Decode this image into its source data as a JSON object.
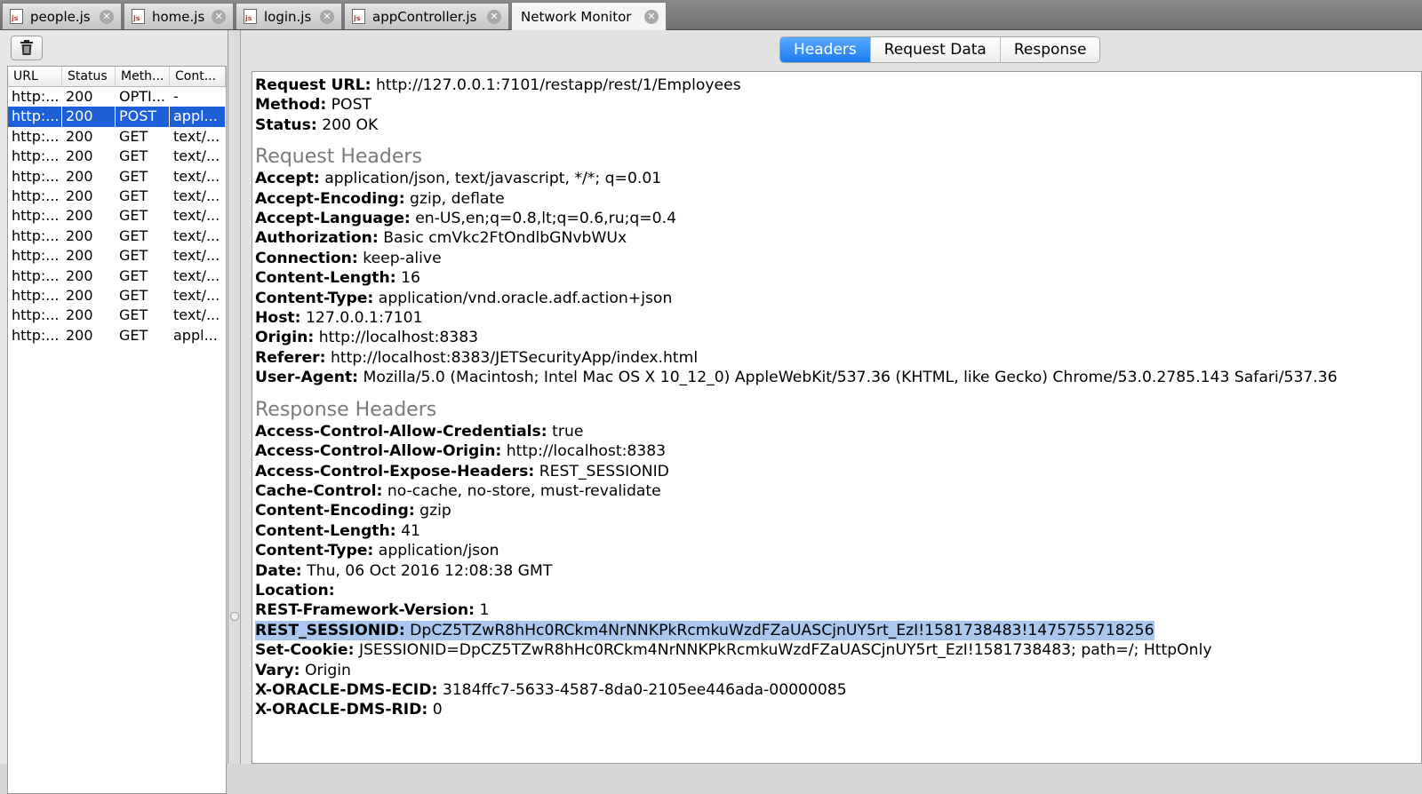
{
  "tabs": [
    {
      "label": "people.js"
    },
    {
      "label": "home.js"
    },
    {
      "label": "login.js"
    },
    {
      "label": "appController.js"
    },
    {
      "label": "Network Monitor"
    }
  ],
  "request_list": {
    "columns": [
      "URL",
      "Status",
      "Meth...",
      "Cont..."
    ],
    "rows": [
      {
        "url": "http:...",
        "status": "200",
        "method": "OPTI...",
        "type": "-"
      },
      {
        "url": "http:...",
        "status": "200",
        "method": "POST",
        "type": "appl..."
      },
      {
        "url": "http:...",
        "status": "200",
        "method": "GET",
        "type": "text/..."
      },
      {
        "url": "http:...",
        "status": "200",
        "method": "GET",
        "type": "text/..."
      },
      {
        "url": "http:...",
        "status": "200",
        "method": "GET",
        "type": "text/..."
      },
      {
        "url": "http:...",
        "status": "200",
        "method": "GET",
        "type": "text/..."
      },
      {
        "url": "http:...",
        "status": "200",
        "method": "GET",
        "type": "text/..."
      },
      {
        "url": "http:...",
        "status": "200",
        "method": "GET",
        "type": "text/..."
      },
      {
        "url": "http:...",
        "status": "200",
        "method": "GET",
        "type": "text/..."
      },
      {
        "url": "http:...",
        "status": "200",
        "method": "GET",
        "type": "text/..."
      },
      {
        "url": "http:...",
        "status": "200",
        "method": "GET",
        "type": "text/..."
      },
      {
        "url": "http:...",
        "status": "200",
        "method": "GET",
        "type": "text/..."
      },
      {
        "url": "http:...",
        "status": "200",
        "method": "GET",
        "type": "appl..."
      }
    ]
  },
  "detail_tabs": [
    "Headers",
    "Request Data",
    "Response"
  ],
  "summary": {
    "request_url_key": "Request URL:",
    "request_url": "http://127.0.0.1:7101/restapp/rest/1/Employees",
    "method_key": "Method:",
    "method": "POST",
    "status_key": "Status:",
    "status": "200 OK"
  },
  "request_headers_title": "Request Headers",
  "request_headers": [
    {
      "key": "Accept:",
      "value": "application/json, text/javascript, */*; q=0.01"
    },
    {
      "key": "Accept-Encoding:",
      "value": "gzip, deflate"
    },
    {
      "key": "Accept-Language:",
      "value": "en-US,en;q=0.8,lt;q=0.6,ru;q=0.4"
    },
    {
      "key": "Authorization:",
      "value": "Basic cmVkc2FtOndlbGNvbWUx"
    },
    {
      "key": "Connection:",
      "value": "keep-alive"
    },
    {
      "key": "Content-Length:",
      "value": "16"
    },
    {
      "key": "Content-Type:",
      "value": "application/vnd.oracle.adf.action+json"
    },
    {
      "key": "Host:",
      "value": "127.0.0.1:7101"
    },
    {
      "key": "Origin:",
      "value": "http://localhost:8383"
    },
    {
      "key": "Referer:",
      "value": "http://localhost:8383/JETSecurityApp/index.html"
    },
    {
      "key": "User-Agent:",
      "value": "Mozilla/5.0 (Macintosh; Intel Mac OS X 10_12_0) AppleWebKit/537.36 (KHTML, like Gecko) Chrome/53.0.2785.143 Safari/537.36"
    }
  ],
  "response_headers_title": "Response Headers",
  "response_headers": [
    {
      "key": "Access-Control-Allow-Credentials:",
      "value": "true"
    },
    {
      "key": "Access-Control-Allow-Origin:",
      "value": "http://localhost:8383"
    },
    {
      "key": "Access-Control-Expose-Headers:",
      "value": "REST_SESSIONID"
    },
    {
      "key": "Cache-Control:",
      "value": "no-cache, no-store, must-revalidate"
    },
    {
      "key": "Content-Encoding:",
      "value": "gzip"
    },
    {
      "key": "Content-Length:",
      "value": "41"
    },
    {
      "key": "Content-Type:",
      "value": "application/json"
    },
    {
      "key": "Date:",
      "value": "Thu, 06 Oct 2016 12:08:38 GMT"
    },
    {
      "key": "Location:",
      "value": ""
    },
    {
      "key": "REST-Framework-Version:",
      "value": "1"
    },
    {
      "key": "REST_SESSIONID:",
      "value": "DpCZ5TZwR8hHc0RCkm4NrNNKPkRcmkuWzdFZaUASCjnUY5rt_EzI!1581738483!1475755718256"
    },
    {
      "key": "Set-Cookie:",
      "value": "JSESSIONID=DpCZ5TZwR8hHc0RCkm4NrNNKPkRcmkuWzdFZaUASCjnUY5rt_EzI!1581738483; path=/; HttpOnly"
    },
    {
      "key": "Vary:",
      "value": "Origin"
    },
    {
      "key": "X-ORACLE-DMS-ECID:",
      "value": "3184ffc7-5633-4587-8da0-2105ee446ada-00000085"
    },
    {
      "key": "X-ORACLE-DMS-RID:",
      "value": "0"
    }
  ],
  "colors": {
    "selection": "#1c5fd6",
    "active_segment": "#1e7bef",
    "highlight": "#aac8ef"
  }
}
